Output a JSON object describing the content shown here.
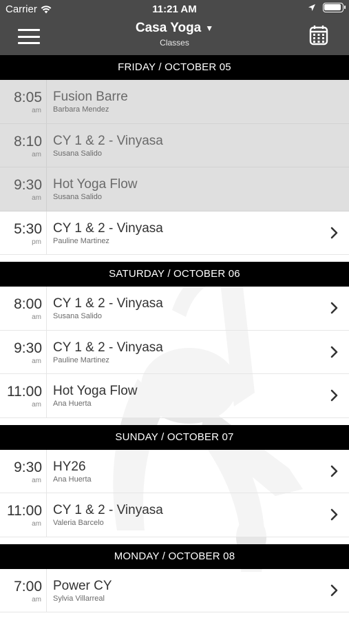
{
  "status": {
    "carrier": "Carrier",
    "time": "11:21 AM"
  },
  "nav": {
    "studio": "Casa Yoga",
    "subtitle": "Classes",
    "menu_icon": "hamburger-menu-icon",
    "calendar_icon": "calendar-icon"
  },
  "days": [
    {
      "header": "FRIDAY / OCTOBER 05",
      "classes": [
        {
          "time": "8:05",
          "ampm": "am",
          "name": "Fusion Barre",
          "teacher": "Barbara Mendez",
          "past": true
        },
        {
          "time": "8:10",
          "ampm": "am",
          "name": "CY 1 & 2 - Vinyasa",
          "teacher": "Susana Salido",
          "past": true
        },
        {
          "time": "9:30",
          "ampm": "am",
          "name": "Hot Yoga Flow",
          "teacher": "Susana Salido",
          "past": true
        },
        {
          "time": "5:30",
          "ampm": "pm",
          "name": "CY 1 & 2 - Vinyasa",
          "teacher": "Pauline Martinez",
          "past": false
        }
      ]
    },
    {
      "header": "SATURDAY / OCTOBER 06",
      "classes": [
        {
          "time": "8:00",
          "ampm": "am",
          "name": "CY 1 & 2 - Vinyasa",
          "teacher": "Susana Salido",
          "past": false
        },
        {
          "time": "9:30",
          "ampm": "am",
          "name": "CY 1 & 2 - Vinyasa",
          "teacher": "Pauline Martinez",
          "past": false
        },
        {
          "time": "11:00",
          "ampm": "am",
          "name": "Hot Yoga Flow",
          "teacher": "Ana Huerta",
          "past": false
        }
      ]
    },
    {
      "header": "SUNDAY / OCTOBER 07",
      "classes": [
        {
          "time": "9:30",
          "ampm": "am",
          "name": "HY26",
          "teacher": "Ana Huerta",
          "past": false
        },
        {
          "time": "11:00",
          "ampm": "am",
          "name": "CY 1 & 2 - Vinyasa",
          "teacher": "Valeria Barcelo",
          "past": false
        }
      ]
    },
    {
      "header": "MONDAY / OCTOBER 08",
      "classes": [
        {
          "time": "7:00",
          "ampm": "am",
          "name": "Power CY",
          "teacher": "Sylvia Villarreal",
          "past": false
        }
      ]
    }
  ],
  "colors": {
    "nav_bg": "#4a4a4a",
    "day_header_bg": "#000000",
    "past_row_bg": "#dcdcdc"
  }
}
